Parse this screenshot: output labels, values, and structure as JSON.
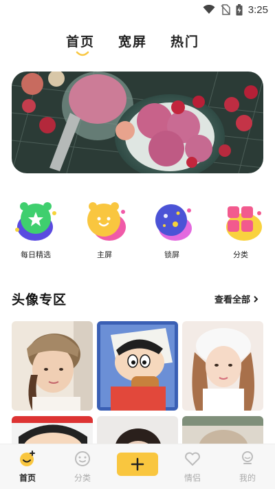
{
  "status": {
    "time": "3:25",
    "icons": [
      "wifi-icon",
      "no-sim-icon",
      "battery-charging-icon"
    ]
  },
  "top_tabs": [
    {
      "label": "首页",
      "active": true
    },
    {
      "label": "宽屏",
      "active": false
    },
    {
      "label": "热门",
      "active": false
    }
  ],
  "banner": {
    "subject": "ice-cream-banner"
  },
  "categories": [
    {
      "label": "每日精选",
      "icon": "daily-pick-icon"
    },
    {
      "label": "主屏",
      "icon": "home-screen-icon"
    },
    {
      "label": "锁屏",
      "icon": "lock-screen-icon"
    },
    {
      "label": "分类",
      "icon": "category-icon"
    }
  ],
  "section": {
    "title": "头像专区",
    "see_all": "查看全部"
  },
  "avatars": [
    "avatar-girl-beanie",
    "avatar-cartoon-boy",
    "avatar-girl-white-hat",
    "avatar-cartoon-boy-2",
    "avatar-girl-2",
    "avatar-girl-3"
  ],
  "bottom_nav": [
    {
      "label": "首页",
      "icon": "home-smile-icon",
      "active": true
    },
    {
      "label": "分类",
      "icon": "category-face-icon",
      "active": false
    },
    {
      "label": "情侣",
      "icon": "couple-heart-icon",
      "active": false
    },
    {
      "label": "我的",
      "icon": "profile-icon",
      "active": false
    }
  ],
  "colors": {
    "accent": "#f9c63f",
    "inactive": "#aaaaaa"
  }
}
